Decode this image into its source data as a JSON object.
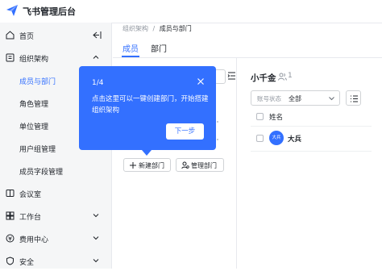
{
  "app": {
    "title": "飞书管理后台",
    "brand_color": "#3370ff"
  },
  "sidebar": {
    "items": [
      {
        "label": "首页",
        "icon": "home-icon"
      },
      {
        "label": "组织架构",
        "icon": "org-icon",
        "expanded": true,
        "children": [
          {
            "label": "成员与部门",
            "active": true
          },
          {
            "label": "角色管理"
          },
          {
            "label": "单位管理"
          },
          {
            "label": "用户组管理"
          },
          {
            "label": "成员字段管理"
          }
        ]
      },
      {
        "label": "会议室",
        "icon": "meeting-room-icon"
      },
      {
        "label": "工作台",
        "icon": "workbench-icon"
      },
      {
        "label": "费用中心",
        "icon": "billing-icon"
      },
      {
        "label": "安全",
        "icon": "security-icon"
      }
    ]
  },
  "breadcrumb": {
    "parent": "组织架构",
    "separator": "/",
    "current": "成员与部门"
  },
  "tabs": [
    {
      "label": "成员",
      "active": true
    },
    {
      "label": "部门",
      "active": false
    }
  ],
  "tree_actions": {
    "new_dept": "新建部门",
    "manage_dept": "管理部门"
  },
  "guide": {
    "step": "1/4",
    "text": "点击这里可以一键创建部门，开始搭建组织架构",
    "next": "下一步"
  },
  "dept": {
    "name": "小千金",
    "member_count": "1",
    "filter_label": "账号状态",
    "filter_value": "全部",
    "column_name": "姓名",
    "members": [
      {
        "avatar_text": "大兵",
        "name": "大兵"
      }
    ]
  }
}
